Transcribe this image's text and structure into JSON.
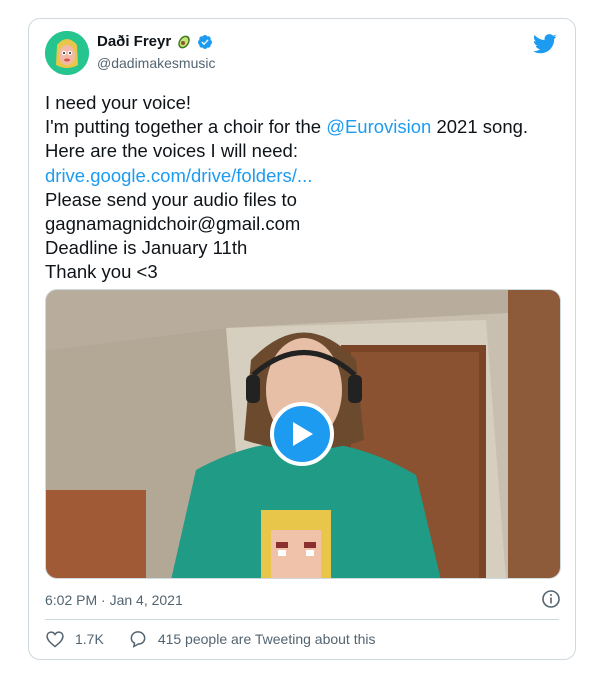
{
  "author": {
    "display_name": "Daði Freyr",
    "handle": "@dadimakesmusic",
    "emoji": "avocado-icon",
    "verified": true
  },
  "tweet": {
    "line1": "I need your voice!",
    "line2_pre": "I'm putting together a choir for the ",
    "line2_mention": "@Eurovision",
    "line2_post": " 2021 song.",
    "line3": "Here are the voices I will need:",
    "link": "drive.google.com/drive/folders/...",
    "line5": "Please send your audio files to",
    "line6": "gagnamagnidchoir@gmail.com",
    "line7": "Deadline is January 11th",
    "line8": "Thank you <3"
  },
  "meta": {
    "timestamp": "6:02 PM · Jan 4, 2021"
  },
  "actions": {
    "likes": "1.7K",
    "conversation": "415 people are Tweeting about this"
  },
  "colors": {
    "accent": "#1d9bf0",
    "text": "#0f1419",
    "secondary": "#536471",
    "border": "#cfd9de"
  }
}
